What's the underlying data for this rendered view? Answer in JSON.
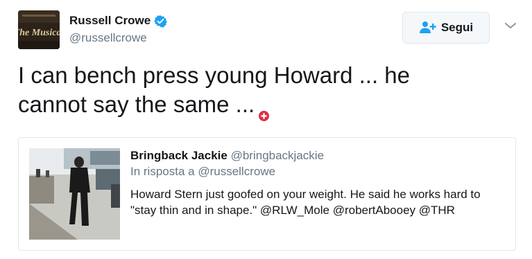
{
  "author": {
    "name": "Russell Crowe",
    "handle": "@russellcrowe",
    "avatar_text": "The Musical",
    "verified": true
  },
  "follow_button": {
    "label": "Segui",
    "icon": "add-user-icon"
  },
  "menu": {
    "icon": "chevron-down-icon"
  },
  "tweet": {
    "line1": "I can bench press young Howard ... he",
    "line2": "cannot say the same ...",
    "emoji": "heavy-plus-sign-icon"
  },
  "quoted": {
    "name": "Bringback Jackie",
    "handle": "@bringbackjackie",
    "reply_to": "In risposta a @russellcrowe",
    "text_line1": "Howard Stern just goofed on your weight. He said he works hard to",
    "text_line2": "\"stay thin and in shape.\" @RLW_Mole @robertAbooey @THR"
  },
  "colors": {
    "text": "#14171a",
    "secondary": "#657786",
    "verified_blue": "#1da1f2",
    "border": "#e1e8ed",
    "emoji_red": "#dd2e44"
  }
}
